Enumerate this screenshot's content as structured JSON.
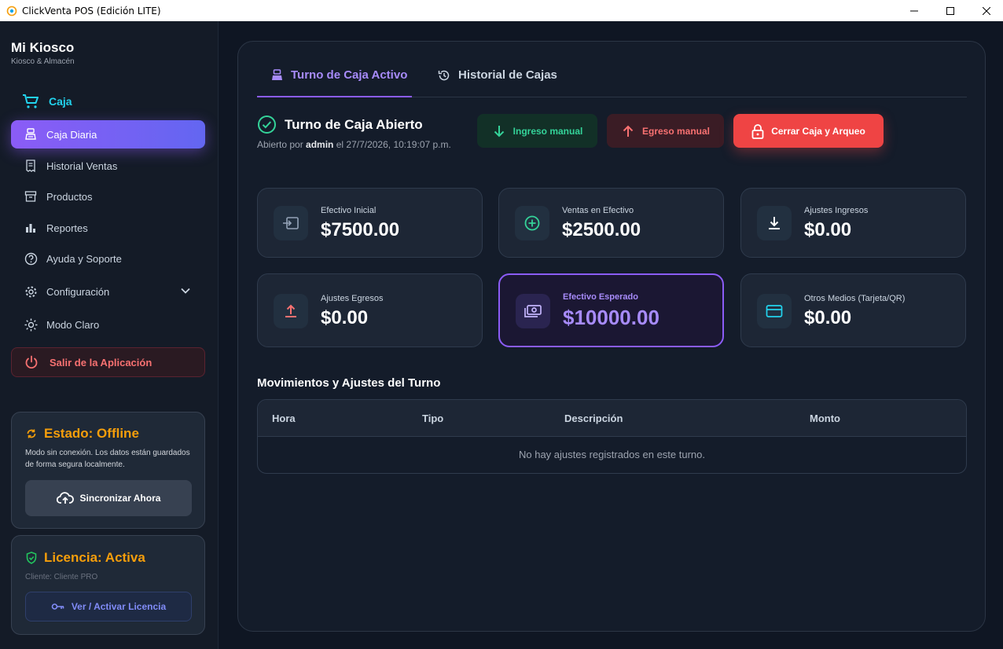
{
  "window": {
    "title": "ClickVenta POS (Edición LITE)"
  },
  "sidebar": {
    "brand": "Mi Kiosco",
    "subtitle": "Kiosco & Almacén",
    "section_label": "Caja",
    "items": [
      {
        "label": "Caja Diaria",
        "icon": "register-icon",
        "active": true
      },
      {
        "label": "Historial Ventas",
        "icon": "receipt-icon"
      },
      {
        "label": "Productos",
        "icon": "archive-icon"
      },
      {
        "label": "Reportes",
        "icon": "bar-chart-icon"
      },
      {
        "label": "Ayuda y Soporte",
        "icon": "help-icon"
      },
      {
        "label": "Configuración",
        "icon": "gear-icon"
      },
      {
        "label": "Modo Claro",
        "icon": "sun-icon"
      }
    ],
    "exit_label": "Salir de la Aplicación",
    "status": {
      "title": "Estado: Offline",
      "description": "Modo sin conexión. Los datos están guardados de forma segura localmente.",
      "sync_label": "Sincronizar Ahora"
    },
    "license": {
      "title": "Licencia: Activa",
      "client": "Cliente: Cliente PRO",
      "button_label": "Ver / Activar Licencia"
    }
  },
  "main": {
    "tabs": [
      {
        "label": "Turno de Caja Activo",
        "active": true
      },
      {
        "label": "Historial de Cajas",
        "active": false
      }
    ],
    "shift": {
      "title": "Turno de Caja Abierto",
      "opened_prefix": "Abierto por ",
      "opened_user": "admin",
      "opened_suffix": " el 27/7/2026, 10:19:07 p.m."
    },
    "actions": {
      "income_label": "Ingreso manual",
      "expense_label": "Egreso manual",
      "close_label": "Cerrar Caja y Arqueo"
    },
    "stats": [
      {
        "label": "Efectivo Inicial",
        "value": "$7500.00",
        "icon": "cash-in-icon"
      },
      {
        "label": "Ventas en Efectivo",
        "value": "$2500.00",
        "icon": "plus-circle-icon"
      },
      {
        "label": "Ajustes Ingresos",
        "value": "$0.00",
        "icon": "download-icon"
      },
      {
        "label": "Ajustes Egresos",
        "value": "$0.00",
        "icon": "upload-icon"
      },
      {
        "label": "Efectivo Esperado",
        "value": "$10000.00",
        "icon": "money-icon",
        "highlight": true
      },
      {
        "label": "Otros Medios (Tarjeta/QR)",
        "value": "$0.00",
        "icon": "card-icon"
      }
    ],
    "movements": {
      "title": "Movimientos y Ajustes del Turno",
      "columns": [
        "Hora",
        "Tipo",
        "Descripción",
        "Monto"
      ],
      "empty_message": "No hay ajustes registrados en este turno."
    }
  },
  "colors": {
    "accent": "#8b5cf6",
    "cyan": "#22d3ee",
    "warning": "#f59e0b",
    "danger": "#ef4444",
    "success": "#34d399"
  }
}
